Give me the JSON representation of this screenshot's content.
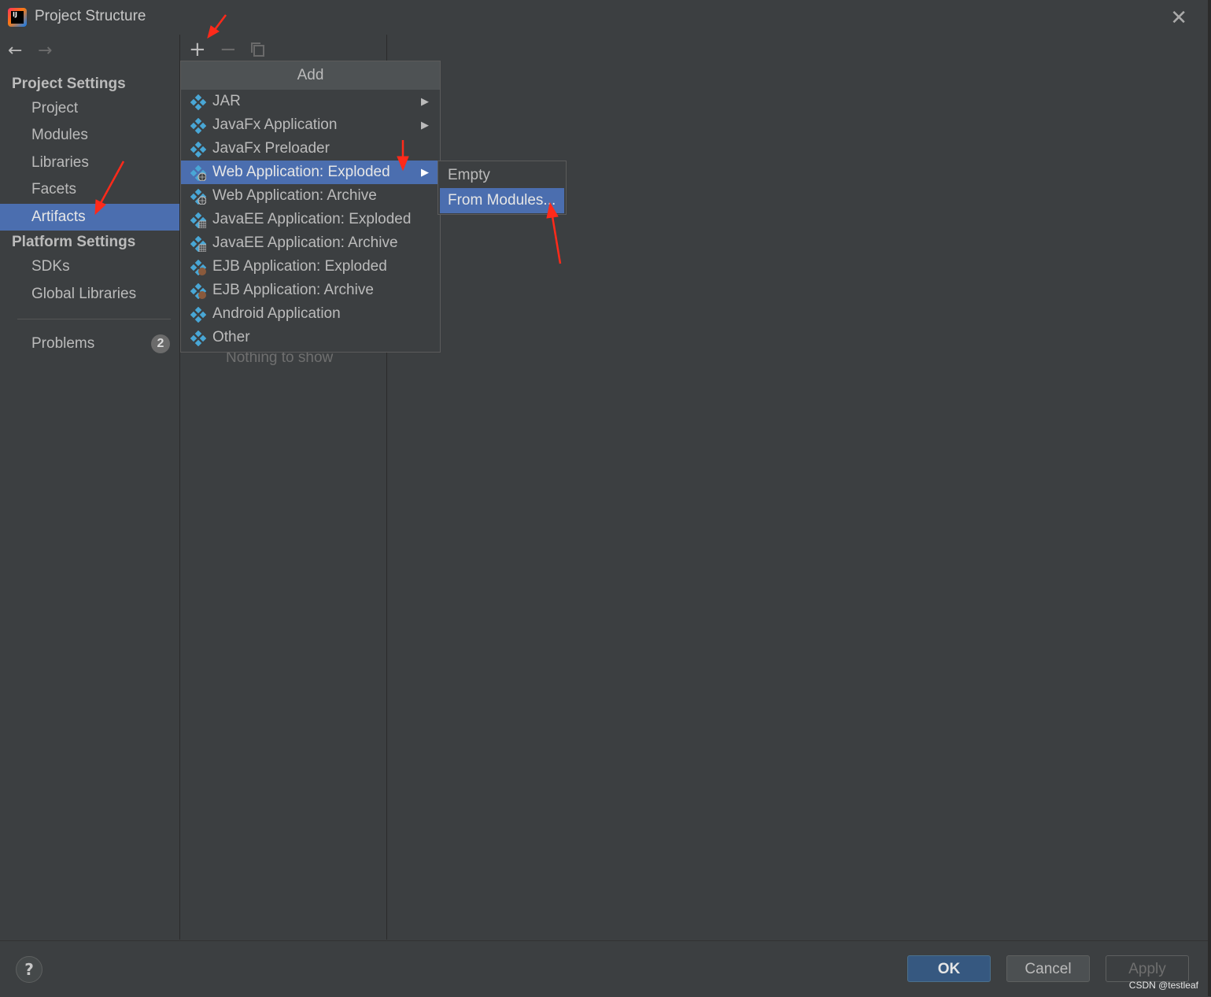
{
  "window": {
    "title": "Project Structure"
  },
  "sidebar": {
    "project_settings_heading": "Project Settings",
    "project_items": [
      "Project",
      "Modules",
      "Libraries",
      "Facets",
      "Artifacts"
    ],
    "selected": "Artifacts",
    "platform_settings_heading": "Platform Settings",
    "platform_items": [
      "SDKs",
      "Global Libraries"
    ],
    "problems_label": "Problems",
    "problems_count": "2"
  },
  "artifacts_list": {
    "empty_text": "Nothing to show"
  },
  "add_menu": {
    "header": "Add",
    "items": [
      {
        "label": "JAR",
        "has_submenu": true,
        "icon": "artifact-icon"
      },
      {
        "label": "JavaFx Application",
        "has_submenu": true,
        "icon": "artifact-icon"
      },
      {
        "label": "JavaFx Preloader",
        "has_submenu": false,
        "icon": "artifact-icon"
      },
      {
        "label": "Web Application: Exploded",
        "has_submenu": true,
        "icon": "web-artifact-icon",
        "active": true
      },
      {
        "label": "Web Application: Archive",
        "has_submenu": false,
        "icon": "web-artifact-icon"
      },
      {
        "label": "JavaEE Application: Exploded",
        "has_submenu": false,
        "icon": "javaee-artifact-icon"
      },
      {
        "label": "JavaEE Application: Archive",
        "has_submenu": false,
        "icon": "javaee-artifact-icon"
      },
      {
        "label": "EJB Application: Exploded",
        "has_submenu": false,
        "icon": "ejb-artifact-icon"
      },
      {
        "label": "EJB Application: Archive",
        "has_submenu": false,
        "icon": "ejb-artifact-icon"
      },
      {
        "label": "Android Application",
        "has_submenu": false,
        "icon": "artifact-icon"
      },
      {
        "label": "Other",
        "has_submenu": false,
        "icon": "artifact-icon"
      }
    ]
  },
  "submenu": {
    "items": [
      "Empty",
      "From Modules..."
    ],
    "active": "From Modules..."
  },
  "buttons": {
    "ok": "OK",
    "cancel": "Cancel",
    "apply": "Apply",
    "help": "?"
  },
  "watermark": "CSDN @testleaf",
  "colors": {
    "selection": "#4b6eaf",
    "background": "#3c3f41",
    "ok_button": "#365880",
    "annotation_arrow": "#ff2a1a"
  }
}
